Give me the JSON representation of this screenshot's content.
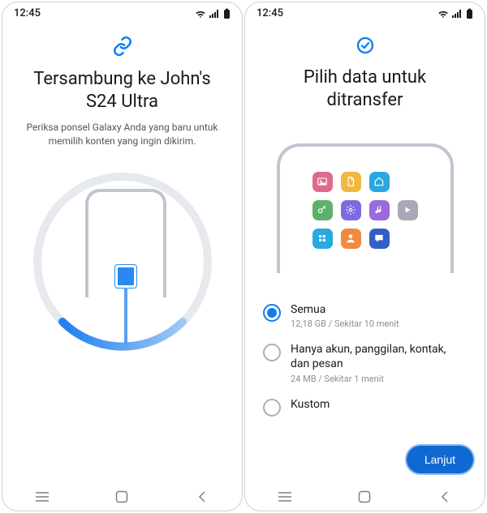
{
  "statusbar": {
    "time": "12:45"
  },
  "left": {
    "title": "Tersambung ke John's S24 Ultra",
    "subtitle": "Periksa ponsel Galaxy Anda yang baru untuk memilih konten yang ingin dikirim."
  },
  "right": {
    "title": "Pilih data untuk ditransfer",
    "options": [
      {
        "label": "Semua",
        "desc": "12,18 GB / Sekitar 10 menit",
        "selected": true
      },
      {
        "label": "Hanya akun, panggilan, kontak, dan pesan",
        "desc": "24 MB / Sekitar 1 menit",
        "selected": false
      },
      {
        "label": "Kustom",
        "desc": "",
        "selected": false
      }
    ],
    "next": "Lanjut"
  },
  "icons": {
    "apps": [
      {
        "name": "gallery",
        "bg": "#e06a8c",
        "glyph": "image"
      },
      {
        "name": "files",
        "bg": "#f0b840",
        "glyph": "file"
      },
      {
        "name": "home",
        "bg": "#2aa8e0",
        "glyph": "home"
      },
      {
        "name": "empty1",
        "bg": "transparent",
        "glyph": ""
      },
      {
        "name": "keys",
        "bg": "#5db06a",
        "glyph": "key"
      },
      {
        "name": "settings",
        "bg": "#7d6ae0",
        "glyph": "gear"
      },
      {
        "name": "music",
        "bg": "#9a6ae0",
        "glyph": "note"
      },
      {
        "name": "play",
        "bg": "#a8a8b8",
        "glyph": "play"
      },
      {
        "name": "grid",
        "bg": "#2aa8e0",
        "glyph": "grid4"
      },
      {
        "name": "contact",
        "bg": "#f08a40",
        "glyph": "person"
      },
      {
        "name": "chat",
        "bg": "#3060c8",
        "glyph": "chat"
      },
      {
        "name": "empty2",
        "bg": "transparent",
        "glyph": ""
      }
    ]
  }
}
